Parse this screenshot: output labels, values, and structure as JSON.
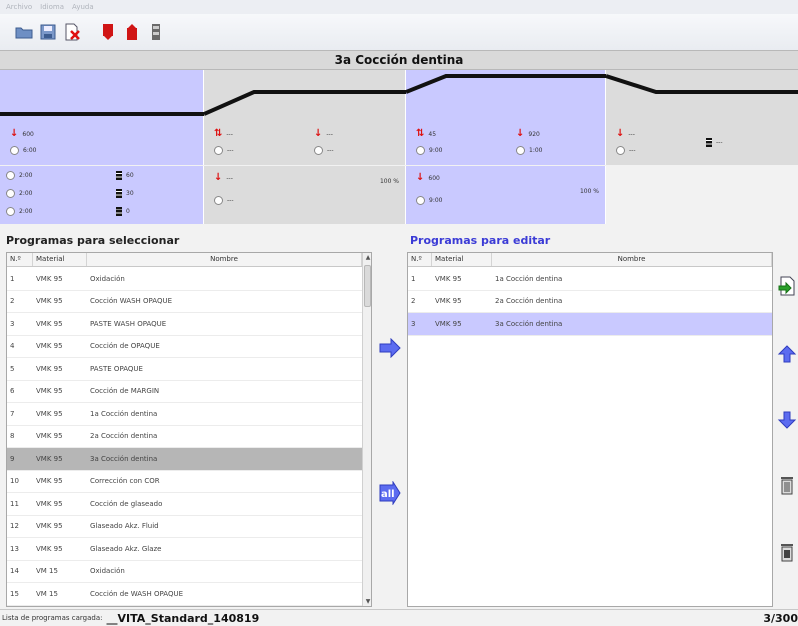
{
  "menu": [
    "Archivo",
    "Idioma",
    "Ayuda"
  ],
  "title": "3a Cocción dentina",
  "phases": {
    "p1": {
      "temp": "600",
      "time": "6:00"
    },
    "p2": {
      "temp_a": "---",
      "time_a": "---",
      "temp_b": "---",
      "time_b": "---"
    },
    "p3": {
      "temp_a": "45",
      "time_a": "9:00",
      "temp_b": "920",
      "time_b": "1:00"
    },
    "p4": {
      "temp": "---",
      "time": "---",
      "vac": "---"
    }
  },
  "lower_row": {
    "p1": {
      "time1": "2:00",
      "time2": "2:00",
      "time3": "2:00",
      "vac1": "60",
      "vac2": "30",
      "vac3": "0"
    },
    "p2": {
      "temp": "---",
      "time": "---",
      "pct": "100 %"
    },
    "p3": {
      "temp": "600",
      "time": "9:00",
      "pct": "100 %"
    }
  },
  "left_section": {
    "title": "Programas para seleccionar",
    "headers": [
      "N.º",
      "Material",
      "Nombre"
    ],
    "rows": [
      {
        "n": "1",
        "mat": "VMK 95",
        "name": "Oxidación"
      },
      {
        "n": "2",
        "mat": "VMK 95",
        "name": "Cocción WASH OPAQUE"
      },
      {
        "n": "3",
        "mat": "VMK 95",
        "name": "PASTE WASH OPAQUE"
      },
      {
        "n": "4",
        "mat": "VMK 95",
        "name": "Cocción de OPAQUE"
      },
      {
        "n": "5",
        "mat": "VMK 95",
        "name": "PASTE OPAQUE"
      },
      {
        "n": "6",
        "mat": "VMK 95",
        "name": "Cocción de MARGIN"
      },
      {
        "n": "7",
        "mat": "VMK 95",
        "name": "1a Cocción dentina"
      },
      {
        "n": "8",
        "mat": "VMK 95",
        "name": "2a Cocción dentina"
      },
      {
        "n": "9",
        "mat": "VMK 95",
        "name": "3a Cocción dentina"
      },
      {
        "n": "10",
        "mat": "VMK 95",
        "name": "Corrección con COR"
      },
      {
        "n": "11",
        "mat": "VMK 95",
        "name": "Cocción de glaseado"
      },
      {
        "n": "12",
        "mat": "VMK 95",
        "name": "Glaseado Akz. Fluid"
      },
      {
        "n": "13",
        "mat": "VMK 95",
        "name": "Glaseado Akz. Glaze"
      },
      {
        "n": "14",
        "mat": "VM 15",
        "name": "Oxidación"
      },
      {
        "n": "15",
        "mat": "VM 15",
        "name": "Cocción de WASH OPAQUE"
      }
    ]
  },
  "right_section": {
    "title": "Programas para editar",
    "headers": [
      "N.º",
      "Material",
      "Nombre"
    ],
    "rows": [
      {
        "n": "1",
        "mat": "VMK 95",
        "name": "1a Cocción dentina"
      },
      {
        "n": "2",
        "mat": "VMK 95",
        "name": "2a Cocción dentina"
      },
      {
        "n": "3",
        "mat": "VMK 95",
        "name": "3a Cocción dentina"
      }
    ]
  },
  "all_button_label": "all",
  "status": {
    "label": "Lista de programas cargada:",
    "value": "__VITA_Standard_140819",
    "count": "3/300"
  },
  "colors": {
    "accent_blue": "#c9c9ff",
    "title_blue": "#3b3bd6",
    "arrow_blue": "#5c6cf0",
    "selection_grey": "#b6b6b6"
  }
}
